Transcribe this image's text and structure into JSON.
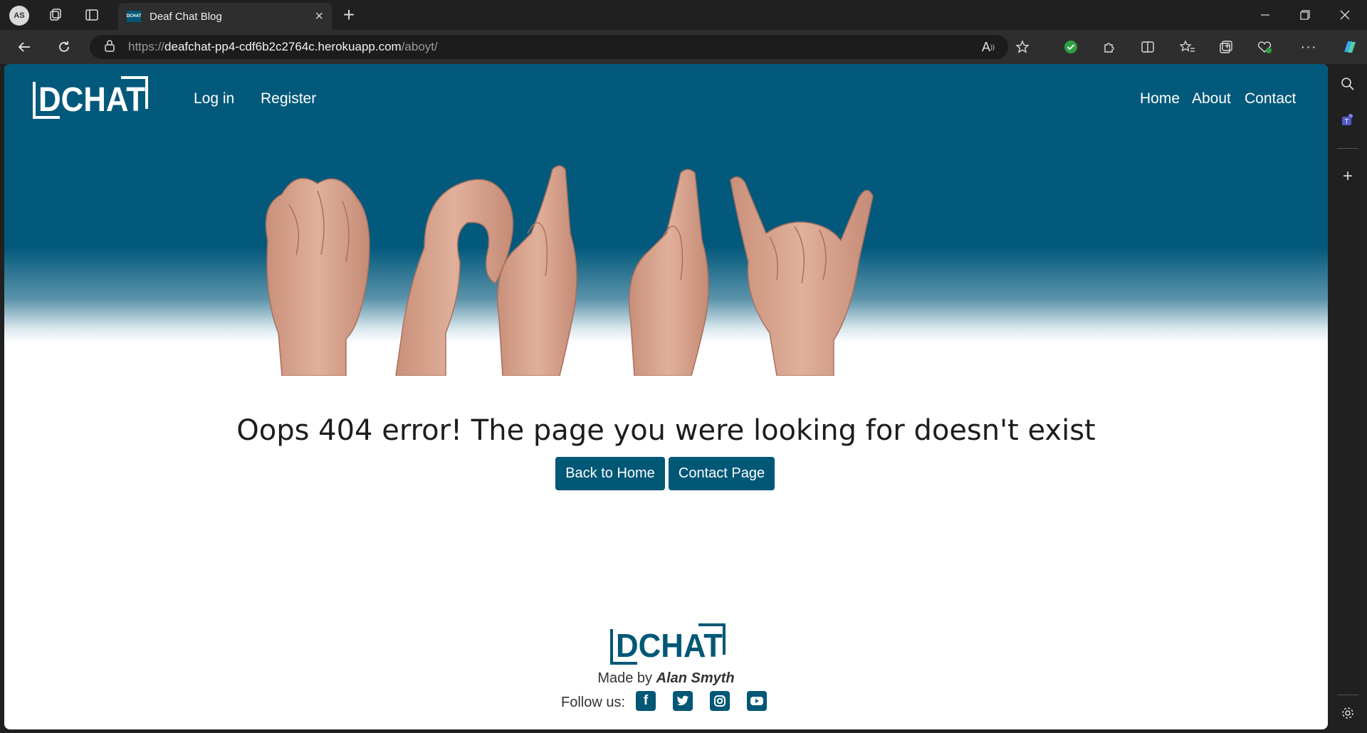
{
  "browser": {
    "profile_initials": "AS",
    "tab_title": "Deaf Chat Blog",
    "tab_favicon_text": "DCHAT",
    "url_scheme": "https://",
    "url_host": "deafchat-pp4-cdf6b2c2764c.herokuapp.com",
    "url_path": "/aboyt/"
  },
  "site": {
    "logo_text": "DCHAT",
    "nav_left": [
      "Log in",
      "Register"
    ],
    "nav_right": [
      "Home",
      "About",
      "Contact"
    ],
    "brand_color": "#005776"
  },
  "main": {
    "error_title": "Oops 404 error! The page you were looking for doesn't exist",
    "back_home_label": "Back to Home",
    "contact_label": "Contact Page"
  },
  "footer": {
    "logo_text": "DCHAT",
    "made_by_prefix": "Made by",
    "author": "Alan Smyth",
    "follow_label": "Follow us:",
    "social_icons": [
      "facebook-icon",
      "twitter-icon",
      "instagram-icon",
      "youtube-icon"
    ]
  }
}
